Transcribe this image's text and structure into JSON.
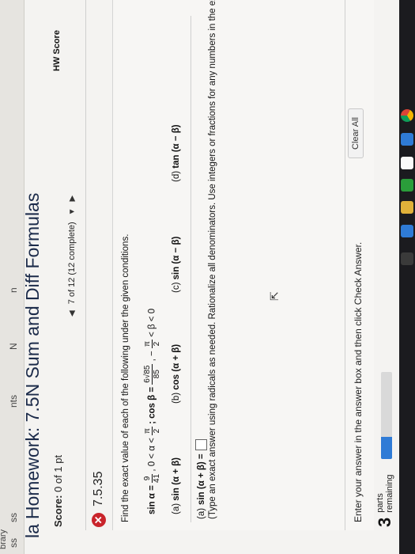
{
  "sidebar": {
    "items": [
      "ss",
      "ss",
      "brary",
      "nts",
      "n"
    ],
    "partial_item": "N"
  },
  "header": {
    "title_prefix": "la",
    "title": "Homework: 7.5N Sum and Diff Formulas",
    "score_label": "Score:",
    "score_value": "0 of 1 pt",
    "hw_score_label": "HW Score",
    "nav_text": "7 of 12 (12 complete)"
  },
  "problem": {
    "number": "7.5.35",
    "status_icon": "x-circle-icon",
    "instruction": "Find the exact value of each of the following under the given conditions.",
    "conditions": {
      "sin_label": "sin α =",
      "sin_num": "9",
      "sin_den": "41",
      "range1": ", 0 < α <",
      "range1_num": "π",
      "range1_den": "2",
      "cos_label": "; cos β =",
      "cos_num": "6√85",
      "cos_den": "85",
      "range2_pre": ", −",
      "range2_num": "π",
      "range2_den": "2",
      "range2_post": "< β < 0"
    },
    "parts": [
      {
        "label": "(a)",
        "expr": "sin (α + β)"
      },
      {
        "label": "(b)",
        "expr": "cos (α + β)"
      },
      {
        "label": "(c)",
        "expr": "sin (α − β)"
      },
      {
        "label": "(d)",
        "expr": "tan (α − β)"
      }
    ],
    "answer_prompt_label": "(a)",
    "answer_prompt_expr": "sin (α + β) =",
    "type_hint": "(Type an exact answer using radicals as needed. Rationalize all denominators. Use integers or fractions for any numbers in the expression.)"
  },
  "footer": {
    "enter_hint": "Enter your answer in the answer box and then click Check Answer.",
    "clear_all": "Clear All",
    "parts_count": "3",
    "parts_word": "parts",
    "parts_remaining": "remaining",
    "progress_fraction": 0.25
  },
  "colors": {
    "accent_blue": "#2f7bd6",
    "error_red": "#c9242b",
    "title_navy": "#1c2b4a"
  }
}
